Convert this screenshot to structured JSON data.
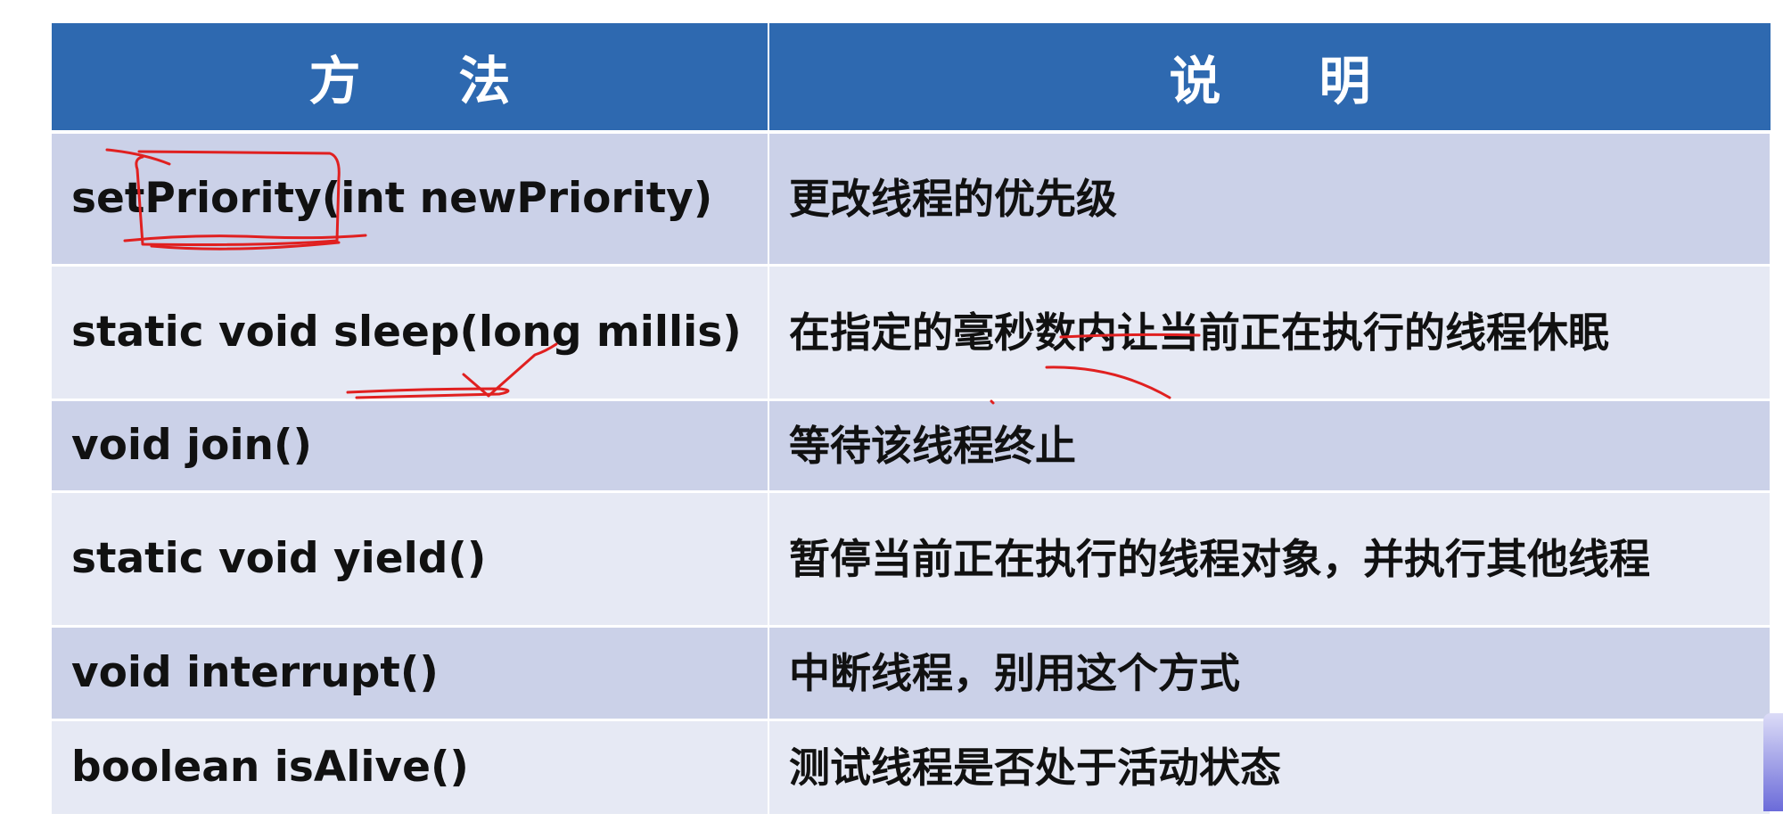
{
  "table": {
    "headers": {
      "method": "方法",
      "description": "说明"
    },
    "rows": [
      {
        "method": "setPriority(int  newPriority)",
        "description": "更改线程的优先级"
      },
      {
        "method": "static void sleep(long millis)",
        "description": "在指定的毫秒数内让当前正在执行的线程休眠"
      },
      {
        "method": "void join()",
        "description": "等待该线程终止"
      },
      {
        "method": "static void yield()",
        "description": "暂停当前正在执行的线程对象，并执行其他线程"
      },
      {
        "method": "void interrupt()",
        "description": "中断线程，别用这个方式"
      },
      {
        "method": "boolean isAlive()",
        "description": "测试线程是否处于活动状态"
      }
    ]
  },
  "colors": {
    "header_bg": "#2e69b0",
    "row_dark": "#cbd1e8",
    "row_light": "#e6e9f4",
    "annotation_ink": "#e02020"
  }
}
